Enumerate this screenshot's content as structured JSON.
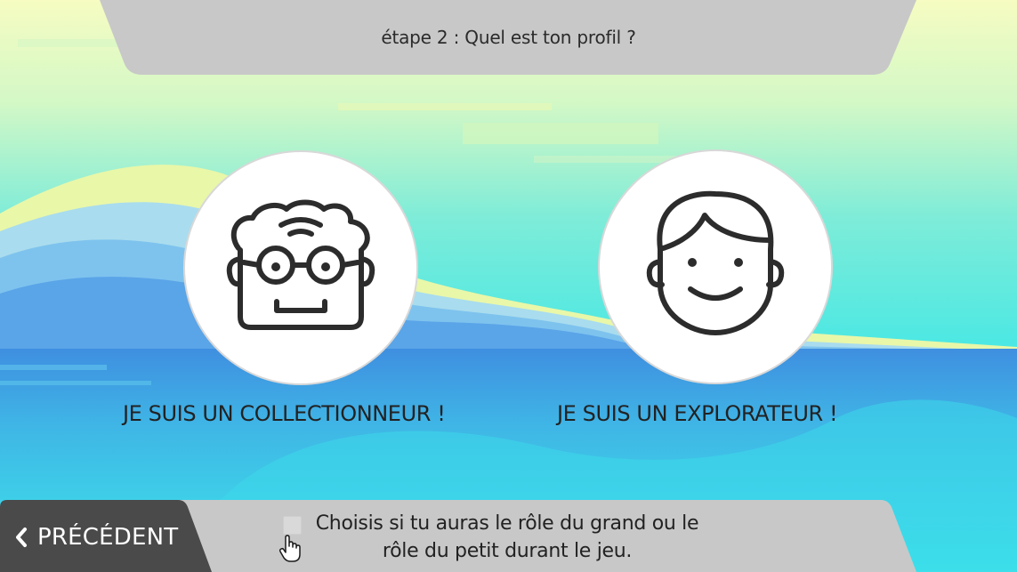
{
  "header": {
    "step_title": "étape 2 : Quel est ton profil ?"
  },
  "profiles": [
    {
      "label": "JE SUIS UN COLLECTIONNEUR !",
      "icon": "grandpa-face-icon"
    },
    {
      "label": "JE SUIS UN EXPLORATEUR !",
      "icon": "boy-face-icon"
    }
  ],
  "footer": {
    "previous_label": "PRÉCÉDENT",
    "hint_line1": "Choisis si tu auras le rôle du grand ou le",
    "hint_line2": "rôle du petit durant le jeu."
  },
  "colors": {
    "sky_top": "#f3fcc0",
    "sea": "#3de6e8",
    "banner": "#c8c8c8",
    "prev_button": "#4a4a4a",
    "text": "#222222"
  }
}
